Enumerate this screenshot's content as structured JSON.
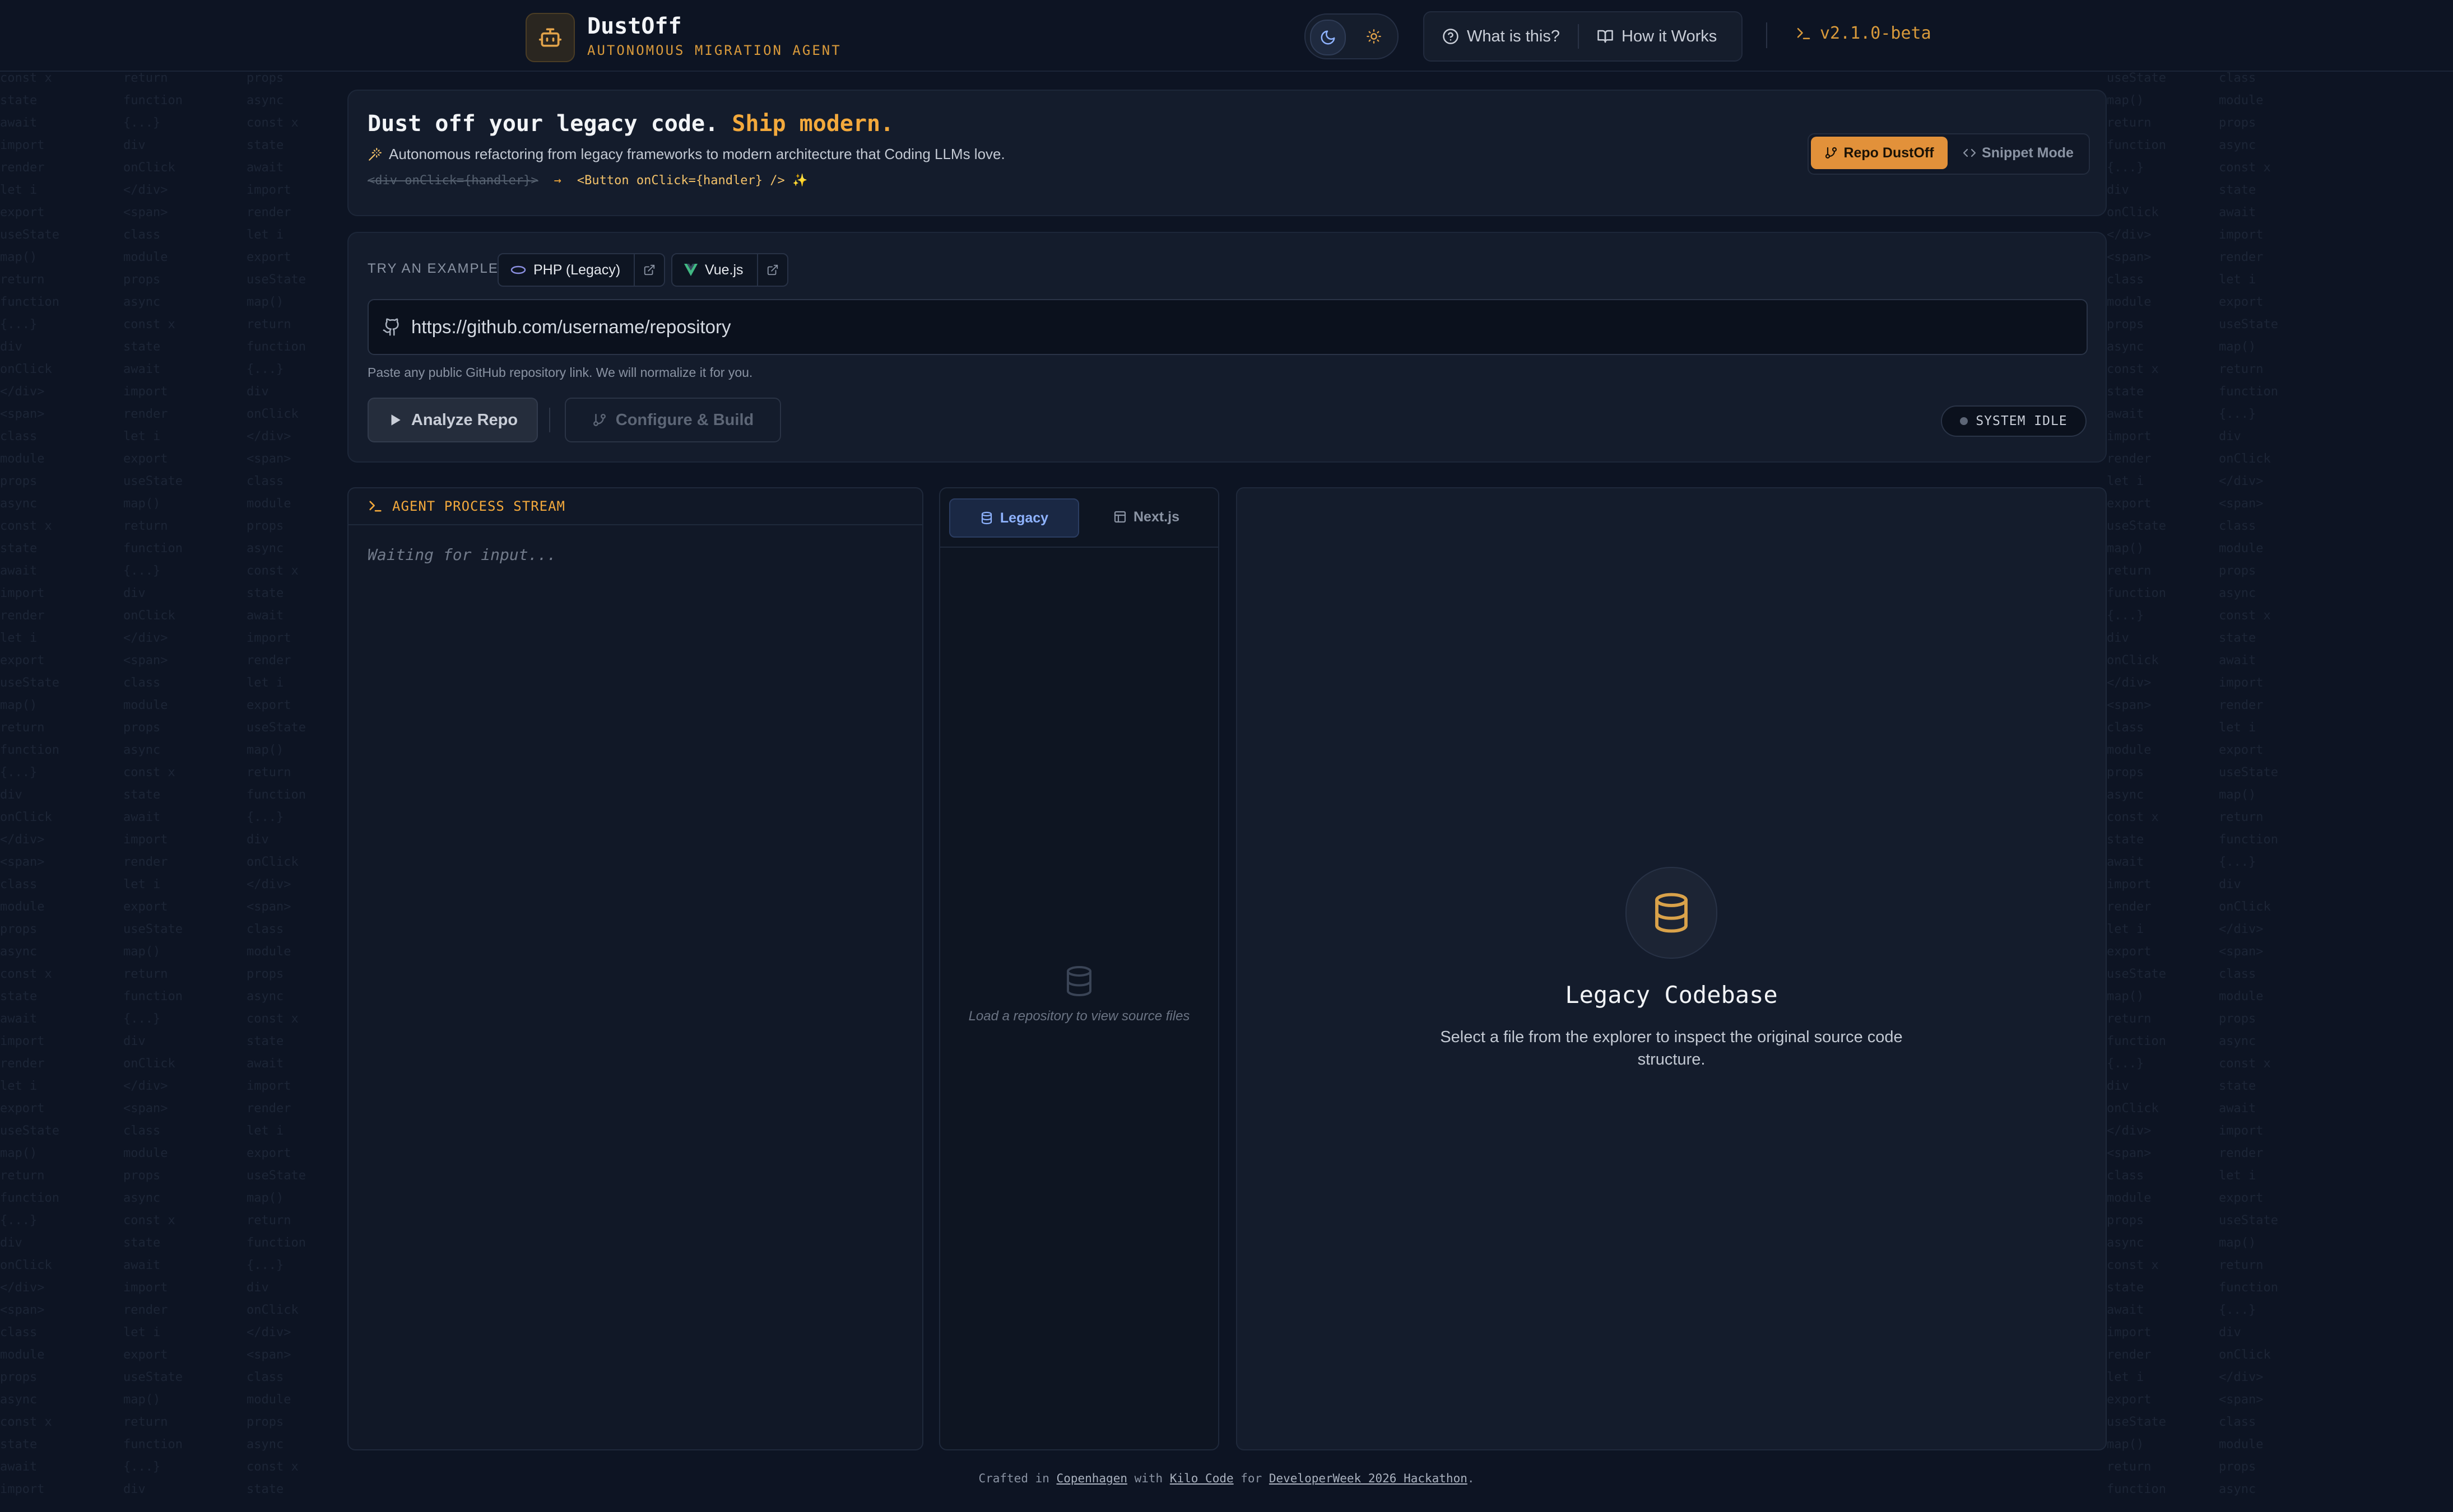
{
  "header": {
    "app_name": "DustOff",
    "tagline": "AUTONOMOUS MIGRATION AGENT",
    "nav": {
      "what_is_this": "What is this?",
      "how_it_works": "How it Works"
    },
    "version": "v2.1.0-beta"
  },
  "hero": {
    "title_main": "Dust off your legacy code.",
    "title_accent": "Ship modern.",
    "subtitle": "Autonomous refactoring from legacy frameworks to modern architecture that Coding LLMs love.",
    "code_old": "<div onClick={handler}>",
    "code_arrow": "→",
    "code_new": "<Button onClick={handler} />",
    "code_sparkle": "✨",
    "modes": {
      "repo": "Repo DustOff",
      "snippet": "Snippet Mode",
      "active": "repo"
    }
  },
  "repo_input": {
    "try_label": "TRY AN EXAMPLE:",
    "examples": [
      {
        "label": "PHP (Legacy)"
      },
      {
        "label": "Vue.js"
      }
    ],
    "url_placeholder": "https://github.com/username/repository",
    "hint": "Paste any public GitHub repository link. We will normalize it for you.",
    "analyze_label": "Analyze Repo",
    "configure_label": "Configure & Build",
    "status": "SYSTEM IDLE"
  },
  "stream": {
    "title": "AGENT PROCESS STREAM",
    "waiting": "Waiting for input..."
  },
  "explorer": {
    "tabs": [
      "Legacy",
      "Next.js"
    ],
    "active_tab": "Legacy",
    "empty_text": "Load a repository to view source files"
  },
  "viewer": {
    "title": "Legacy Codebase",
    "description": "Select a file from the explorer to inspect the original source code structure."
  },
  "footer": {
    "t1": "Crafted in ",
    "link1": "Copenhagen",
    "t2": " with ",
    "link2": "Kilo Code",
    "t3": " for ",
    "link3": "DeveloperWeek 2026 Hackathon",
    "t4": "."
  },
  "colors": {
    "background": "#0d1423",
    "accent": "#f3a93c",
    "accent_button": "#e2913a",
    "active_tab": "#8fb3ff"
  }
}
